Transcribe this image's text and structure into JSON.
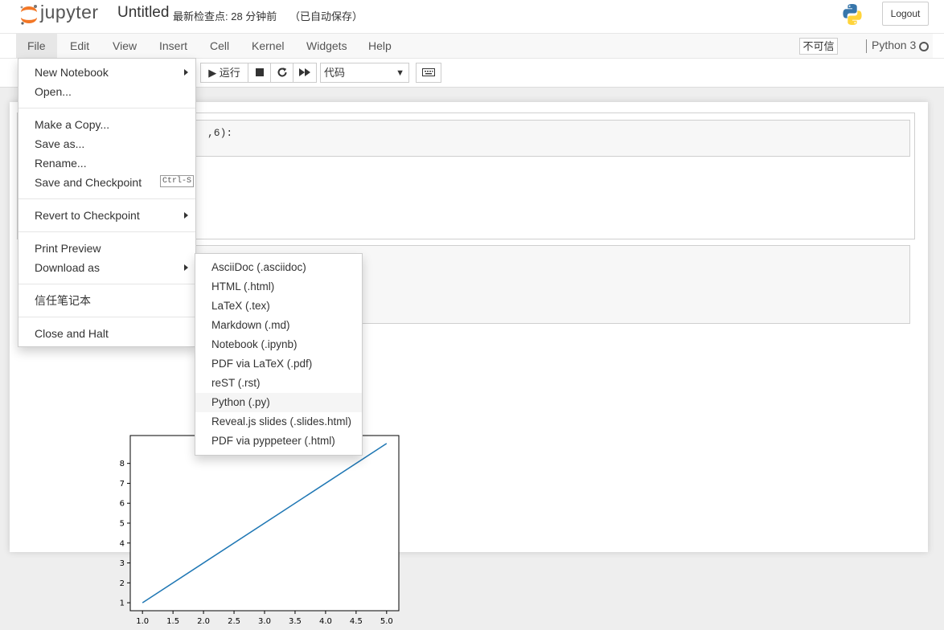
{
  "header": {
    "logo_text": "jupyter",
    "notebook_title": "Untitled",
    "checkpoint": "最新检查点: 28 分钟前",
    "autosave": "（已自动保存）",
    "logout_label": "Logout"
  },
  "menubar": {
    "items": [
      "File",
      "Edit",
      "View",
      "Insert",
      "Cell",
      "Kernel",
      "Widgets",
      "Help"
    ],
    "trust_label": "不可信",
    "kernel_name": "Python 3"
  },
  "toolbar": {
    "run_label": "▶ 运行",
    "cell_type": "代码"
  },
  "cells": {
    "code_fragment": ",6):"
  },
  "file_menu": {
    "new_notebook": "New Notebook",
    "open": "Open...",
    "make_copy": "Make a Copy...",
    "save_as": "Save as...",
    "rename": "Rename...",
    "save_checkpoint": "Save and Checkpoint",
    "save_shortcut": "Ctrl-S",
    "revert": "Revert to Checkpoint",
    "print_preview": "Print Preview",
    "download_as": "Download as",
    "trust_notebook": "信任笔记本",
    "close_halt": "Close and Halt"
  },
  "download_menu": {
    "items": [
      "AsciiDoc (.asciidoc)",
      "HTML (.html)",
      "LaTeX (.tex)",
      "Markdown (.md)",
      "Notebook (.ipynb)",
      "PDF via LaTeX (.pdf)",
      "reST (.rst)",
      "Python (.py)",
      "Reveal.js slides (.slides.html)",
      "PDF via pyppeteer (.html)"
    ],
    "hovered_index": 7
  },
  "chart_data": {
    "type": "line",
    "x": [
      1.0,
      5.0
    ],
    "y": [
      1,
      9
    ],
    "xticks": [
      "1.0",
      "1.5",
      "2.0",
      "2.5",
      "3.0",
      "3.5",
      "4.0",
      "4.5",
      "5.0"
    ],
    "yticks": [
      "1",
      "2",
      "3",
      "4",
      "5",
      "6",
      "7",
      "8"
    ],
    "xlim": [
      0.8,
      5.2
    ],
    "ylim": [
      0.6,
      9.4
    ],
    "line_color": "#1f77b4"
  },
  "colors": {
    "jupyter_orange": "#f37726",
    "python_blue": "#3776ab",
    "python_yellow": "#ffd43b"
  }
}
